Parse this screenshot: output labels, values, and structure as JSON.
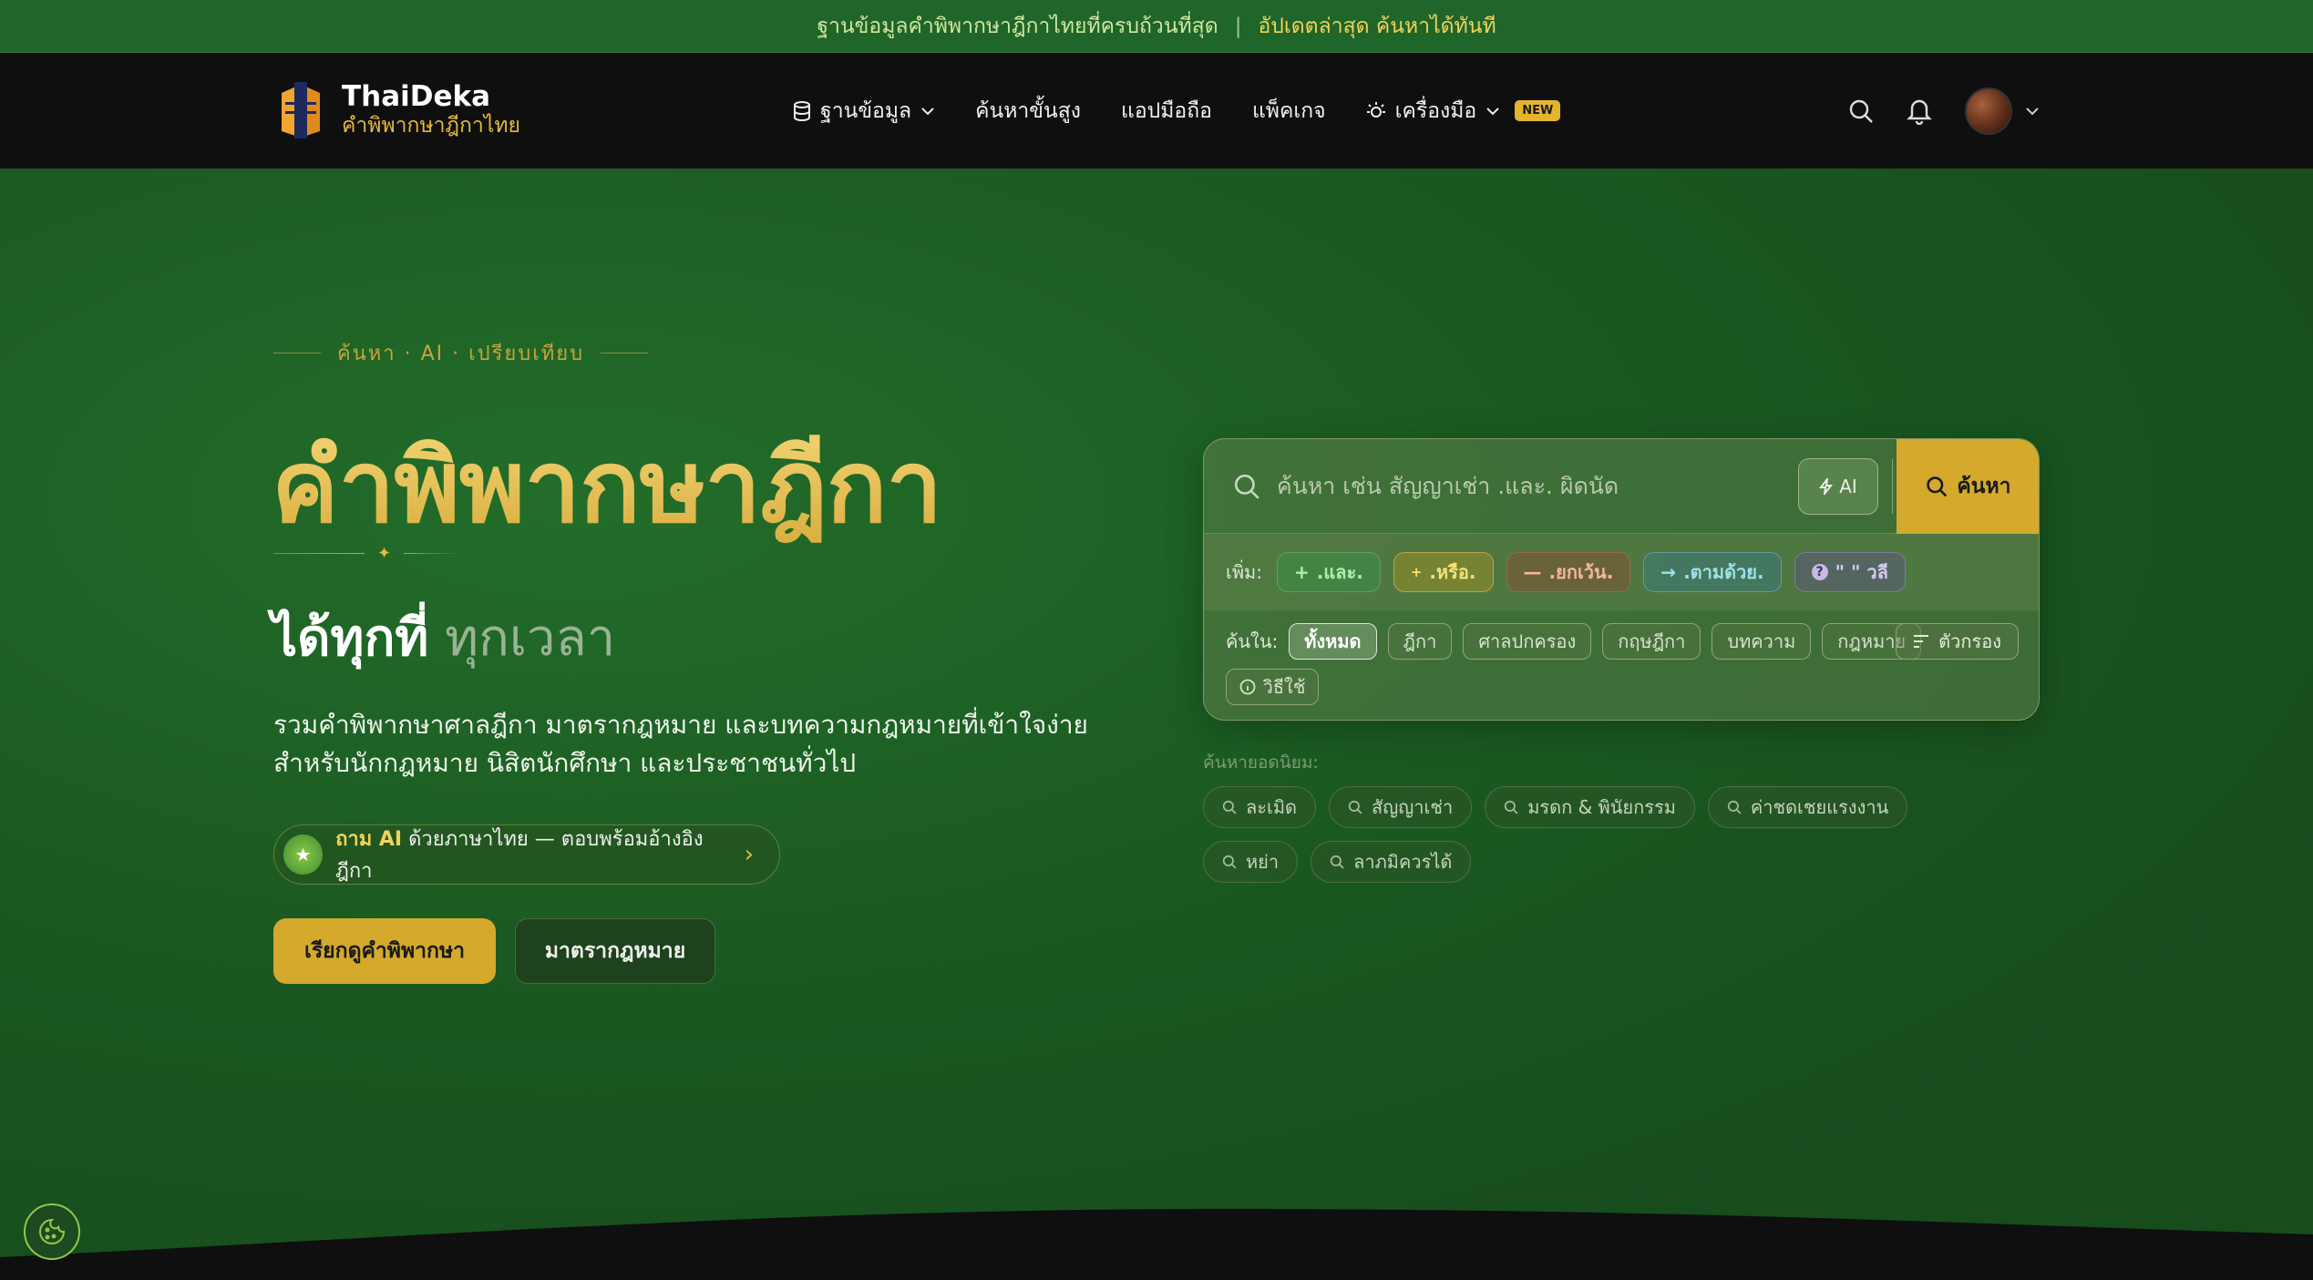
{
  "announcement": {
    "text1": "ฐานข้อมูลคำพิพากษาฎีกาไทยที่ครบถ้วนที่สุด",
    "separator": "|",
    "text2": "อัปเดตล่าสุด ค้นหาได้ทันที"
  },
  "brand": {
    "name": "ThaiDeka",
    "subtitle": "คำพิพากษาฎีกาไทย"
  },
  "nav": {
    "items": [
      {
        "label": "ฐานข้อมูล",
        "icon": "database-icon",
        "dropdown": true
      },
      {
        "label": "ค้นหาขั้นสูง"
      },
      {
        "label": "แอปมือถือ"
      },
      {
        "label": "แพ็คเกจ"
      },
      {
        "label": "เครื่องมือ",
        "icon": "lightbulb-icon",
        "dropdown": true,
        "badge": "NEW"
      }
    ]
  },
  "hero": {
    "kicker": "ค้นหา · AI · เปรียบเทียบ",
    "title": "คำพิพากษาฎีกา",
    "tagline_bold": "ได้ทุกที่",
    "tagline_light": "ทุกเวลา",
    "description_line1": "รวมคำพิพากษาศาลฎีกา มาตรากฎหมาย และบทความกฎหมายที่เข้าใจง่าย",
    "description_line2": "สำหรับนักกฎหมาย นิสิตนักศึกษา และประชาชนทั่วไป",
    "ai_pill_gold": "ถาม AI",
    "ai_pill_text": "ด้วยภาษาไทย — ตอบพร้อมอ้างอิงฎีกา",
    "primary_button": "เรียกดูคำพิพากษา",
    "secondary_button": "มาตรากฎหมาย"
  },
  "search": {
    "placeholder": "ค้นหา เช่น สัญญาเช่า .และ. ผิดนัด",
    "ai_label": "AI",
    "submit_label": "ค้นหา",
    "ops_label": "เพิ่ม:",
    "operators": [
      {
        "symbol": "+",
        "label": ".และ.",
        "kind": "and"
      },
      {
        "symbol": "+",
        "label": ".หรือ.",
        "kind": "or"
      },
      {
        "symbol": "—",
        "label": ".ยกเว้น.",
        "kind": "not"
      },
      {
        "symbol": "→",
        "label": ".ตามด้วย.",
        "kind": "near"
      },
      {
        "symbol": "?",
        "label": "\" \" วลี",
        "kind": "phr"
      }
    ],
    "scope_label": "ค้นใน:",
    "scopes": [
      "ทั้งหมด",
      "ฎีกา",
      "ศาลปกครอง",
      "กฤษฎีกา",
      "บทความ",
      "กฎหมาย"
    ],
    "active_scope": "ทั้งหมด",
    "filter_label": "ตัวกรอง",
    "howto_label": "วิธีใช้"
  },
  "popular": {
    "label": "ค้นหายอดนิยม:",
    "tags": [
      "ละเมิด",
      "สัญญาเช่า",
      "มรดก & พินัยกรรม",
      "ค่าชดเชยแรงงาน",
      "หย่า",
      "ลาภมิควรได้"
    ]
  },
  "colors": {
    "accent_gold": "#d4a92c",
    "hero_green": "#1b5a22",
    "nav_bg": "#0f0f0f",
    "announce_bg": "#20652a"
  }
}
